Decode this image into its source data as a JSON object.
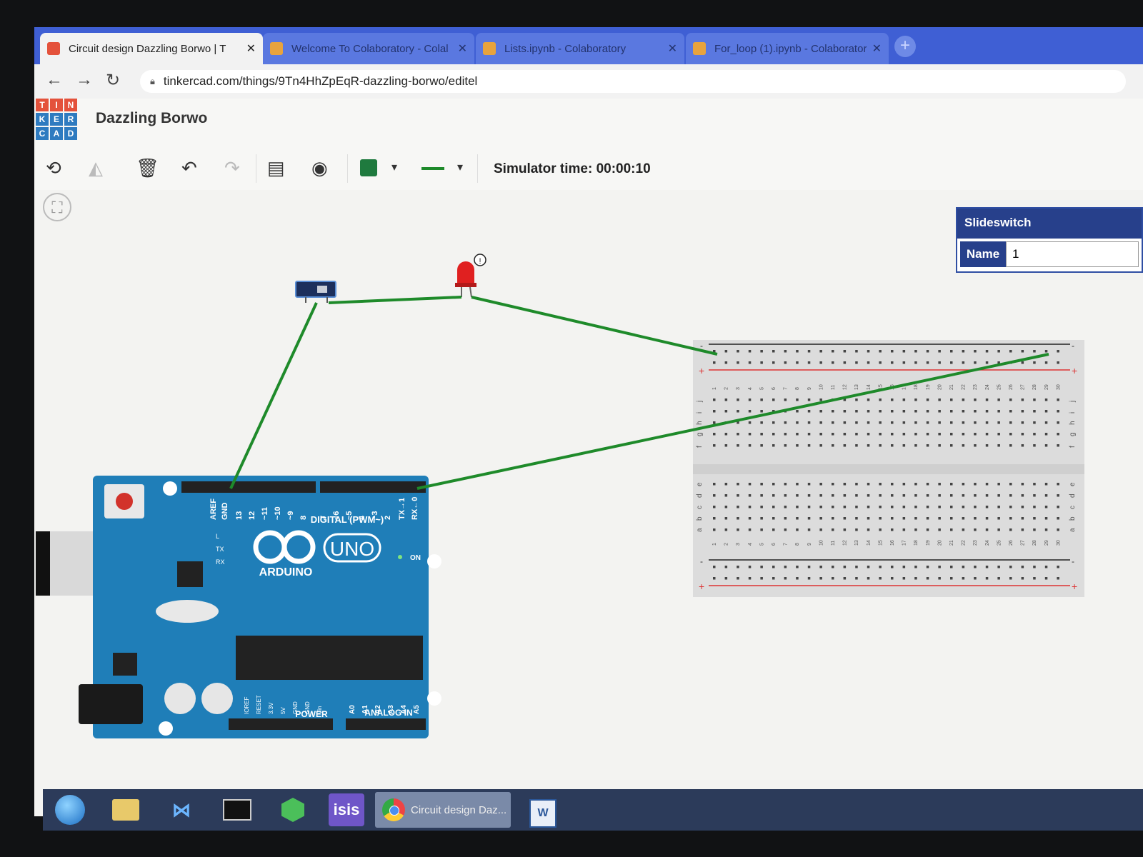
{
  "browser": {
    "tabs": [
      {
        "title": "Circuit design Dazzling Borwo | T",
        "favicon_color": "#e4523b",
        "active": true
      },
      {
        "title": "Welcome To Colaboratory - Colal",
        "favicon_color": "#e8a33d",
        "active": false
      },
      {
        "title": "Lists.ipynb - Colaboratory",
        "favicon_color": "#e8a33d",
        "active": false
      },
      {
        "title": "For_loop (1).ipynb - Colaboratory",
        "favicon_color": "#e8a33d",
        "active": false
      }
    ],
    "tab_close_glyph": "✕",
    "new_tab_glyph": "+",
    "url": "tinkercad.com/things/9Tn4HhZpEqR-dazzling-borwo/editel"
  },
  "app": {
    "logo_letters": [
      "T",
      "I",
      "N",
      "K",
      "E",
      "R",
      "C",
      "A",
      "D"
    ],
    "logo_colors": [
      "#e4523b",
      "#e4523b",
      "#e4523b",
      "#2e7bc0",
      "#2e7bc0",
      "#2e7bc0",
      "#2e7bc0",
      "#2e7bc0",
      "#2e7bc0"
    ],
    "project_name": "Dazzling Borwo",
    "simulator_time": "Simulator time: 00:00:10",
    "wire_color": "#1e8a2a",
    "component_color_swatch": "#1f7a3e"
  },
  "inspector": {
    "title": "Slideswitch",
    "name_label": "Name",
    "name_value": "1"
  },
  "arduino": {
    "brand": "ARDUINO",
    "model": "UNO",
    "digital_label": "DIGITAL (PWM~)",
    "power_label": "POWER",
    "analog_label": "ANALOG IN",
    "on_label": "ON",
    "header_pins": [
      "AREF",
      "GND",
      "13",
      "12",
      "~11",
      "~10",
      "~9",
      "8",
      "7",
      "~6",
      "~5",
      "4",
      "~3",
      "2",
      "TX→1",
      "RX←0"
    ],
    "side_labels": [
      "L",
      "TX",
      "RX"
    ],
    "power_pins": [
      "IOREF",
      "RESET",
      "3.3V",
      "5V",
      "GND",
      "GND",
      "Vin"
    ],
    "analog_pins": [
      "A0",
      "A1",
      "A2",
      "A3",
      "A4",
      "A5"
    ]
  },
  "breadboard": {
    "rows_top": [
      "j",
      "i",
      "h",
      "g",
      "f"
    ],
    "rows_bottom": [
      "e",
      "d",
      "c",
      "b",
      "a"
    ],
    "columns": 30,
    "rail_minus": "-",
    "rail_plus": "+"
  },
  "taskbar": {
    "items": [
      "start-orb",
      "file-explorer",
      "visual-studio",
      "command-prompt",
      "green-app",
      "isis",
      "chrome",
      "word"
    ],
    "isis_label": "isis",
    "chrome_window": "Circuit design Daz..."
  }
}
